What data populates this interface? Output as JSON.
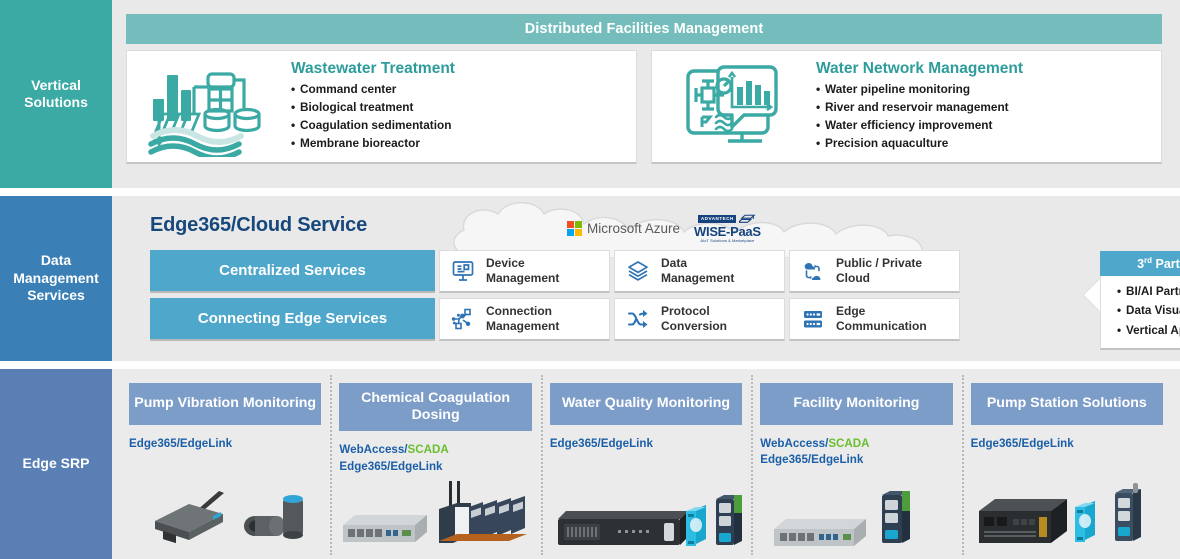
{
  "bands": {
    "vertical": {
      "label": "Vertical Solutions",
      "header": "Distributed Facilities Management",
      "cards": [
        {
          "icon": "wastewater-plant-icon",
          "title": "Wastewater Treatment",
          "bullets": [
            "Command center",
            "Biological treatment",
            "Coagulation sedimentation",
            "Membrane bioreactor"
          ]
        },
        {
          "icon": "water-network-monitor-icon",
          "title": "Water Network Management",
          "bullets": [
            "Water pipeline monitoring",
            "River and reservoir management",
            "Water efficiency improvement",
            "Precision aquaculture"
          ]
        }
      ]
    },
    "data": {
      "label": "Data Management Services",
      "title": "Edge365/Cloud Service",
      "cloud_logos": {
        "microsoft": "Microsoft Azure",
        "wise": {
          "brand": "ADVANTECH",
          "name": "WISE-PaaS",
          "sub": "AIoT Solutions & Marketplace"
        }
      },
      "rows": [
        {
          "name": "Centralized Services",
          "items": [
            {
              "icon": "device-monitor-icon",
              "line1": "Device",
              "line2": "Management"
            },
            {
              "icon": "data-layers-icon",
              "line1": "Data",
              "line2": "Management"
            },
            {
              "icon": "cloud-sync-icon",
              "line1": "Public / Private",
              "line2": "Cloud"
            }
          ]
        },
        {
          "name": "Connecting Edge Services",
          "items": [
            {
              "icon": "network-nodes-icon",
              "line1": "Connection",
              "line2": "Management"
            },
            {
              "icon": "protocol-arrows-icon",
              "line1": "Protocol",
              "line2": "Conversion"
            },
            {
              "icon": "edge-gateway-icon",
              "line1": "Edge",
              "line2": "Communication"
            }
          ]
        }
      ],
      "third_party": {
        "title_prefix": "3",
        "title_sup": "rd",
        "title_suffix": " Party Platform",
        "bullets": [
          "BI/AI Partners",
          "Data Visualization",
          "Vertical App."
        ]
      }
    },
    "edge": {
      "label": "Edge SRP",
      "columns": [
        {
          "title": "Pump Vibration Monitoring",
          "tags": [
            {
              "text": "Edge365/EdgeLink",
              "color": "blue"
            }
          ],
          "products": [
            "wireless-gateway",
            "vibration-sensor"
          ]
        },
        {
          "title": "Chemical Coagulation Dosing",
          "tags": [
            {
              "text": "WebAccess/",
              "color": "blue",
              "suffix": "SCADA",
              "suffix_color": "green"
            },
            {
              "text": "Edge365/EdgeLink",
              "color": "blue"
            }
          ],
          "products": [
            "embedded-box-pc",
            "din-rail-io-stack"
          ]
        },
        {
          "title": "Water Quality Monitoring",
          "tags": [
            {
              "text": "Edge365/EdgeLink",
              "color": "blue"
            }
          ],
          "products": [
            "rack-server",
            "adam-module",
            "edge-gateway"
          ]
        },
        {
          "title": "Facility Monitoring",
          "tags": [
            {
              "text": "WebAccess/",
              "color": "blue",
              "suffix": "SCADA",
              "suffix_color": "green"
            },
            {
              "text": "Edge365/EdgeLink",
              "color": "blue"
            }
          ],
          "products": [
            "embedded-box-pc",
            "edge-gateway"
          ]
        },
        {
          "title": "Pump Station Solutions",
          "tags": [
            {
              "text": "Edge365/EdgeLink",
              "color": "blue"
            }
          ],
          "products": [
            "fanless-box-pc",
            "adam-module",
            "edge-gateway"
          ]
        }
      ]
    }
  },
  "colors": {
    "teal_sidebar": "#3BA9A4",
    "teal_header": "#74BDBC",
    "teal_title": "#2E9C9C",
    "blue_sidebar": "#3A7FB5",
    "blue_service": "#4FA8CC",
    "navy_title": "#17487B",
    "edge_sidebar": "#5A7FB4",
    "edge_card_header": "#7D9DC9",
    "tag_blue": "#1B5FA8",
    "tag_green": "#6BBE2E",
    "band_bg": "#e9e9e9"
  }
}
